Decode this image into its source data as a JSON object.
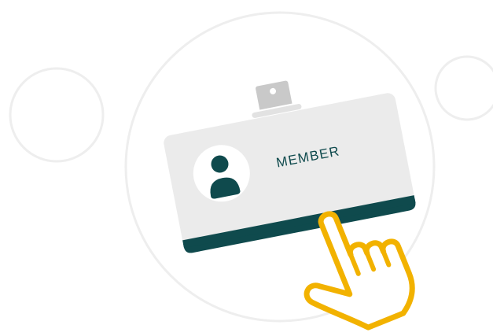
{
  "card": {
    "label": "MEMBER"
  },
  "colors": {
    "background": "#ffffff",
    "ring": "#eeeeee",
    "card_body": "#ebebeb",
    "card_stripe": "#0f4a4d",
    "accent_dark": "#0f4a4d",
    "avatar_bg": "#ffffff",
    "clip": "#c9c9c9",
    "hand_outline": "#f2b200",
    "hand_fill": "#ffffff"
  },
  "icons": {
    "avatar": "person-silhouette-icon",
    "clip": "badge-clip-icon",
    "hand": "pointing-hand-icon"
  }
}
